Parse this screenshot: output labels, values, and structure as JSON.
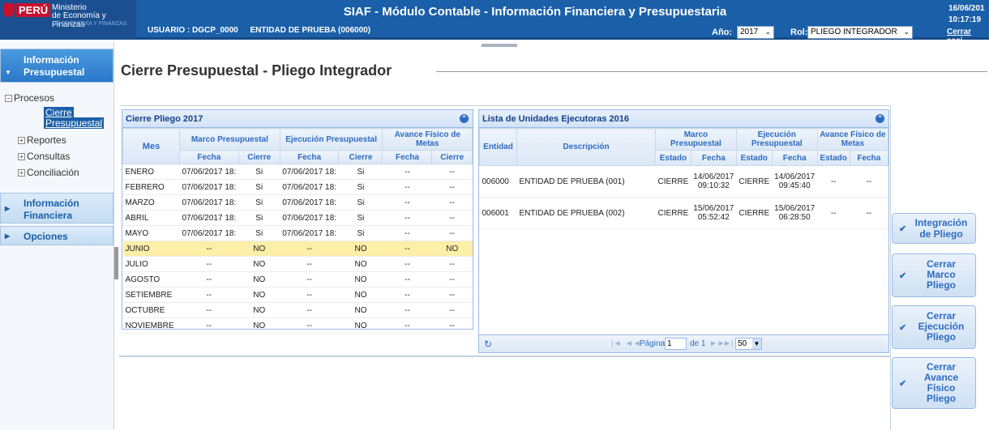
{
  "header": {
    "country": "PERÚ",
    "ministry_line1": "Ministerio",
    "ministry_line2": "de Economía y Finanzas",
    "ministry_line3": "DE ECONOMÍA Y FINANZAS",
    "title": "SIAF - Módulo Contable - Información Financiera y Presupuestaria",
    "usuario": "USUARIO : DGCP_0000",
    "entidad": "ENTIDAD DE PRUEBA (006000)",
    "anio_label": "Año:",
    "anio_value": "2017",
    "rol_label": "Rol:",
    "rol_value": "PLIEGO INTEGRADOR",
    "date": "16/06/201",
    "time": "10:17:19",
    "logout": "Cerrar sesi"
  },
  "sidebar": {
    "acc1_line1": "Información",
    "acc1_line2": "Presupuestal",
    "tree": {
      "procesos": "Procesos",
      "cierre_line1": "Cierre",
      "cierre_line2": "Presupuestal",
      "reportes": "Reportes",
      "consultas": "Consultas",
      "conciliacion": "Conciliación"
    },
    "acc2_line1": "Información",
    "acc2_line2": "Financiera",
    "acc3": "Opciones"
  },
  "main": {
    "page_title": "Cierre Presupuestal - Pliego Integrador"
  },
  "left_panel": {
    "title": "Cierre Pliego 2017",
    "col_mes": "Mes",
    "group_marco": "Marco Presupuestal",
    "group_ejec": "Ejecución Presupuestal",
    "group_avance": "Avance Físico de Metas",
    "col_fecha": "Fecha",
    "col_cierre": "Cierre",
    "rows": [
      [
        "ENERO",
        "07/06/2017 18:",
        "Si",
        "07/06/2017 18:",
        "Si",
        "--",
        "--"
      ],
      [
        "FEBRERO",
        "07/06/2017 18:",
        "Si",
        "07/06/2017 18:",
        "Si",
        "--",
        "--"
      ],
      [
        "MARZO",
        "07/06/2017 18:",
        "Si",
        "07/06/2017 18:",
        "Si",
        "--",
        "--"
      ],
      [
        "ABRIL",
        "07/06/2017 18:",
        "Si",
        "07/06/2017 18:",
        "Si",
        "--",
        "--"
      ],
      [
        "MAYO",
        "07/06/2017 18:",
        "Si",
        "07/06/2017 18:",
        "Si",
        "--",
        "--"
      ],
      [
        "JUNIO",
        "--",
        "NO",
        "--",
        "NO",
        "--",
        "NO"
      ],
      [
        "JULIO",
        "--",
        "NO",
        "--",
        "NO",
        "--",
        "--"
      ],
      [
        "AGOSTO",
        "--",
        "NO",
        "--",
        "NO",
        "--",
        "--"
      ],
      [
        "SETIEMBRE",
        "--",
        "NO",
        "--",
        "NO",
        "--",
        "--"
      ],
      [
        "OCTUBRE",
        "--",
        "NO",
        "--",
        "NO",
        "--",
        "--"
      ],
      [
        "NOVIEMBRE",
        "--",
        "NO",
        "--",
        "NO",
        "--",
        "--"
      ]
    ]
  },
  "right_panel": {
    "title": "Lista de Unidades Ejecutoras 2016",
    "col_entidad": "Entidad",
    "col_desc": "Descripción",
    "group_marco": "Marco Presupuestal",
    "group_ejec": "Ejecución Presupuestal",
    "group_avance": "Avance Físico de Metas",
    "col_estado": "Estado",
    "col_fecha": "Fecha",
    "rows": [
      {
        "entidad": "006000",
        "desc": "ENTIDAD DE PRUEBA (001)",
        "m_estado": "CIERRE",
        "m_fecha1": "14/06/2017",
        "m_fecha2": "09:10:32",
        "e_estado": "CIERRE",
        "e_fecha1": "14/06/2017",
        "e_fecha2": "09:45:40",
        "a_estado": "--",
        "a_fecha": "--"
      },
      {
        "entidad": "006001",
        "desc": "ENTIDAD DE PRUEBA (002)",
        "m_estado": "CIERRE",
        "m_fecha1": "15/06/2017",
        "m_fecha2": "05:52:42",
        "e_estado": "CIERRE",
        "e_fecha1": "15/06/2017",
        "e_fecha2": "06:28:50",
        "a_estado": "--",
        "a_fecha": "--"
      }
    ],
    "pager": {
      "pagina": "Página",
      "page_value": "1",
      "de": "de 1",
      "size": "50"
    }
  },
  "actions": {
    "integracion_l1": "Integración",
    "integracion_l2": "de Pliego",
    "marco_l1": "Cerrar",
    "marco_l2": "Marco",
    "marco_l3": "Pliego",
    "ejec_l1": "Cerrar",
    "ejec_l2": "Ejecución",
    "ejec_l3": "Pliego",
    "avance_l1": "Cerrar",
    "avance_l2": "Avance",
    "avance_l3": "Físico",
    "avance_l4": "Pliego"
  }
}
